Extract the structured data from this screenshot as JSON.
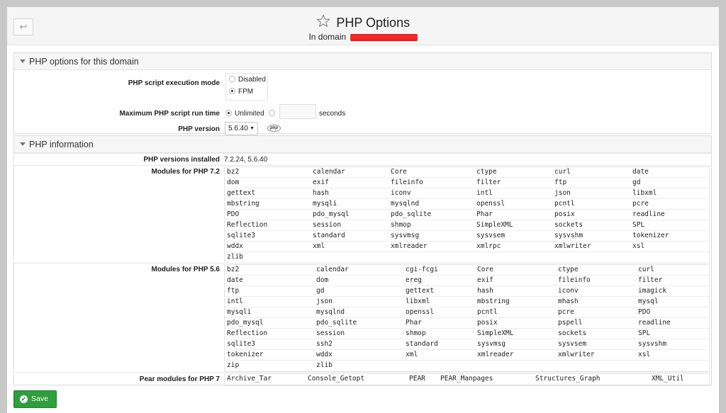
{
  "header": {
    "back_icon": "↩",
    "title": "PHP Options",
    "domain_prefix": "In domain"
  },
  "options": {
    "section_title": "PHP options for this domain",
    "exec_mode_label": "PHP script execution mode",
    "exec_disabled": "Disabled",
    "exec_fpm": "FPM",
    "exec_selected": "FPM",
    "max_time_label": "Maximum PHP script run time",
    "max_time_unlimited": "Unlimited",
    "max_time_seconds": "seconds",
    "max_time_selected": "Unlimited",
    "version_label": "PHP version",
    "version_value": "5.6.40",
    "php_logo_text": "php"
  },
  "info": {
    "section_title": "PHP information",
    "installed_label": "PHP versions installed",
    "installed_value": "7.2.24, 5.6.40",
    "mod72_label": "Modules for PHP 7.2",
    "mod56_label": "Modules for PHP 5.6",
    "pear_label": "Pear modules for PHP 7",
    "modules72": [
      [
        "bz2",
        "calendar",
        "Core",
        "ctype",
        "curl",
        "date"
      ],
      [
        "dom",
        "exif",
        "fileinfo",
        "filter",
        "ftp",
        "gd"
      ],
      [
        "gettext",
        "hash",
        "iconv",
        "intl",
        "json",
        "libxml"
      ],
      [
        "mbstring",
        "mysqli",
        "mysqlnd",
        "openssl",
        "pcntl",
        "pcre"
      ],
      [
        "PDO",
        "pdo_mysql",
        "pdo_sqlite",
        "Phar",
        "posix",
        "readline"
      ],
      [
        "Reflection",
        "session",
        "shmop",
        "SimpleXML",
        "sockets",
        "SPL"
      ],
      [
        "sqlite3",
        "standard",
        "sysvmsg",
        "sysvsem",
        "sysvshm",
        "tokenizer"
      ],
      [
        "wddx",
        "xml",
        "xmlreader",
        "xmlrpc",
        "xmlwriter",
        "xsl"
      ],
      [
        "zlib"
      ]
    ],
    "modules56": [
      [
        "bz2",
        "calendar",
        "cgi-fcgi",
        "Core",
        "ctype",
        "curl"
      ],
      [
        "date",
        "dom",
        "ereg",
        "exif",
        "fileinfo",
        "filter"
      ],
      [
        "ftp",
        "gd",
        "gettext",
        "hash",
        "iconv",
        "imagick"
      ],
      [
        "intl",
        "json",
        "libxml",
        "mbstring",
        "mhash",
        "mysql"
      ],
      [
        "mysqli",
        "mysqlnd",
        "openssl",
        "pcntl",
        "pcre",
        "PDO"
      ],
      [
        "pdo_mysql",
        "pdo_sqlite",
        "Phar",
        "posix",
        "pspell",
        "readline"
      ],
      [
        "Reflection",
        "session",
        "shmop",
        "SimpleXML",
        "sockets",
        "SPL"
      ],
      [
        "sqlite3",
        "ssh2",
        "standard",
        "sysvmsg",
        "sysvsem",
        "sysvshm"
      ],
      [
        "tokenizer",
        "wddx",
        "xml",
        "xmlreader",
        "xmlwriter",
        "xsl"
      ],
      [
        "zip",
        "zlib"
      ]
    ],
    "pear": [
      "Archive_Tar",
      "Console_Getopt",
      "PEAR",
      "PEAR_Manpages",
      "Structures_Graph",
      "XML_Util"
    ]
  },
  "footer": {
    "save_label": "Save",
    "save_icon": "✔"
  },
  "colors": {
    "save_green": "#2e9e3e",
    "redaction": "#ff2a2a"
  }
}
